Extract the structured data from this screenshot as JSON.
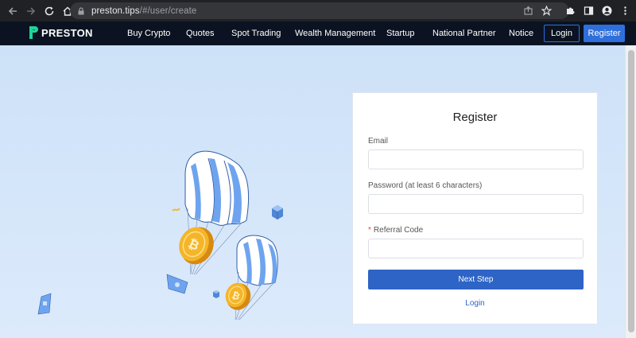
{
  "browser": {
    "url_host": "preston.tips",
    "url_path": "/#/user/create"
  },
  "header": {
    "brand": "PRESTON",
    "nav": [
      "Buy Crypto",
      "Quotes",
      "Spot Trading",
      "Wealth Management",
      "Startup",
      "National Partner",
      "Notice"
    ],
    "login_label": "Login",
    "register_label": "Register"
  },
  "form": {
    "title": "Register",
    "email_label": "Email",
    "email_value": "",
    "password_label": "Password (at least 6 characters)",
    "password_value": "",
    "referral_required_mark": "*",
    "referral_label": "Referral Code",
    "referral_value": "",
    "next_label": "Next Step",
    "login_link": "Login"
  },
  "colors": {
    "accent": "#2d64c6",
    "header_bg": "#0b1322",
    "brand_green": "#1fd39a"
  }
}
